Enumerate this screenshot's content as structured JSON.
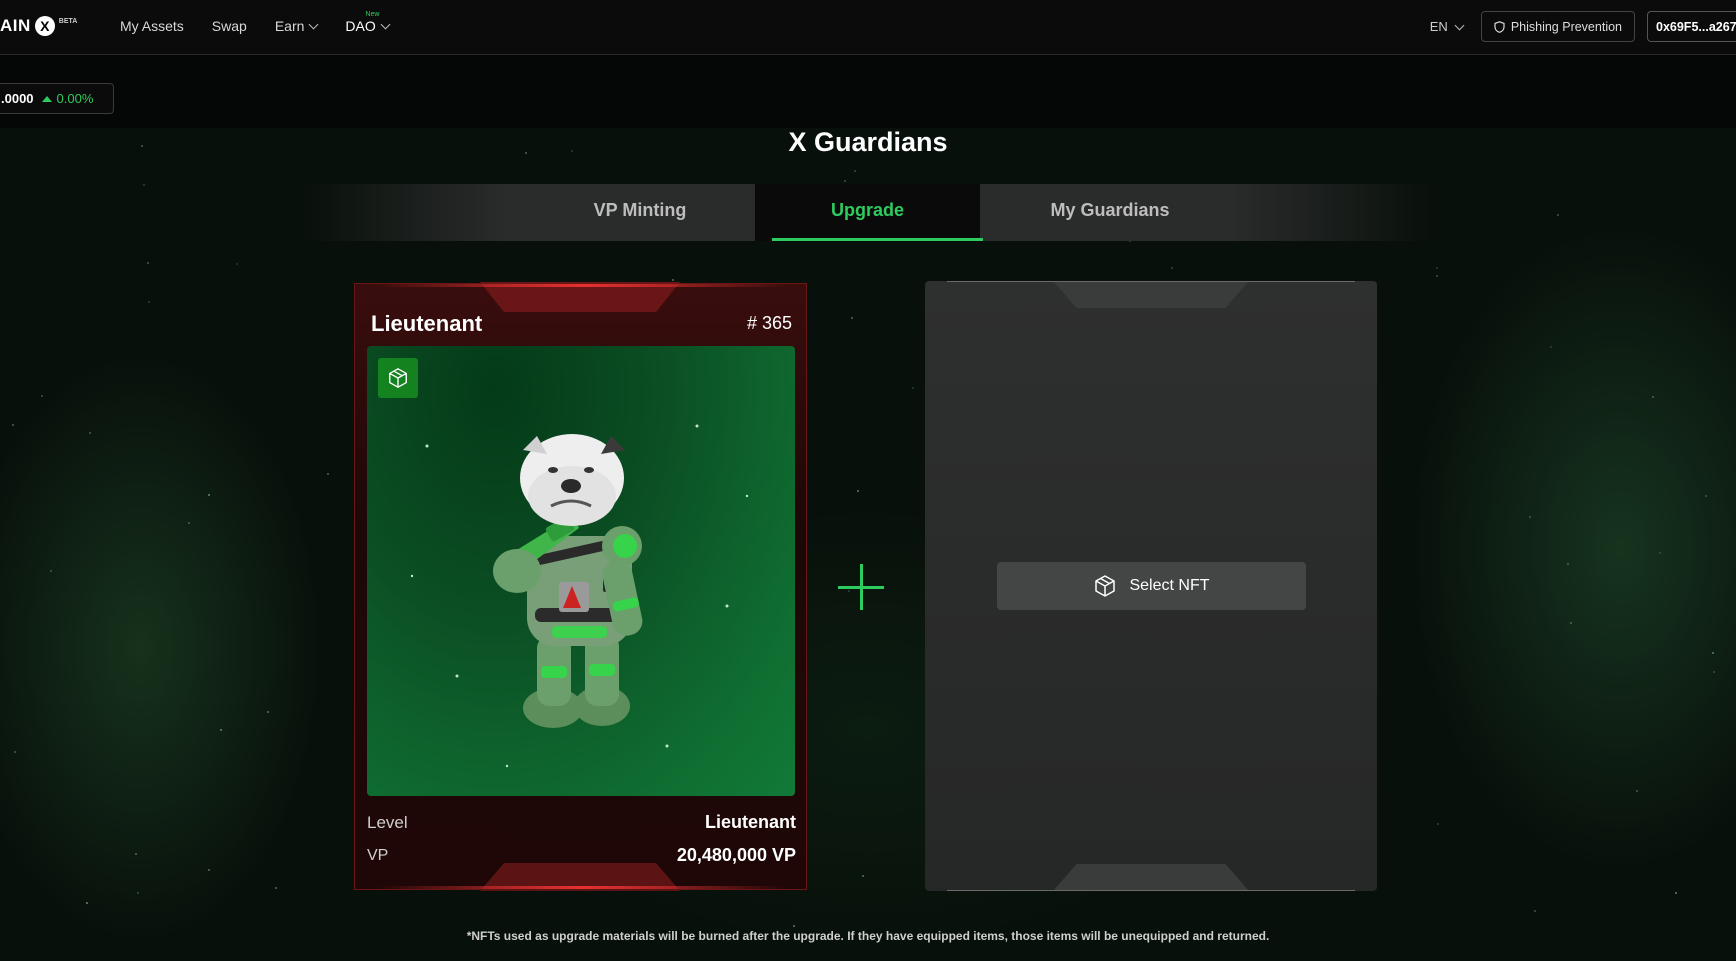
{
  "header": {
    "logo_text": "AIN",
    "logo_x": "X",
    "logo_badge": "BETA",
    "nav": [
      {
        "label": "My Assets"
      },
      {
        "label": "Swap"
      },
      {
        "label": "Earn"
      },
      {
        "label": "DAO",
        "badge": "New"
      }
    ],
    "language": "EN",
    "phishing_label": "Phishing Prevention",
    "wallet_address": "0x69F5...a267"
  },
  "price_ticker": {
    "value": ".0000",
    "change": "0.00%",
    "change_color": "#2ecc5f"
  },
  "page": {
    "title": "X Guardians",
    "tabs": [
      {
        "label": "VP Minting",
        "active": false
      },
      {
        "label": "Upgrade",
        "active": true
      },
      {
        "label": "My Guardians",
        "active": false
      }
    ]
  },
  "selected_nft": {
    "rank": "Lieutenant",
    "token_id": "# 365",
    "level_label": "Level",
    "level_value": "Lieutenant",
    "vp_label": "VP",
    "vp_value": "20,480,000 VP",
    "badge_icon": "cube-icon"
  },
  "empty_slot": {
    "select_label": "Select NFT"
  },
  "footnote": "*NFTs used as upgrade materials will be burned after the upgrade. If they have equipped items, those items will be unequipped and returned.",
  "colors": {
    "accent": "#2ecc5f",
    "card_red": "#6b1515",
    "card_gray": "#2a2b2b"
  }
}
